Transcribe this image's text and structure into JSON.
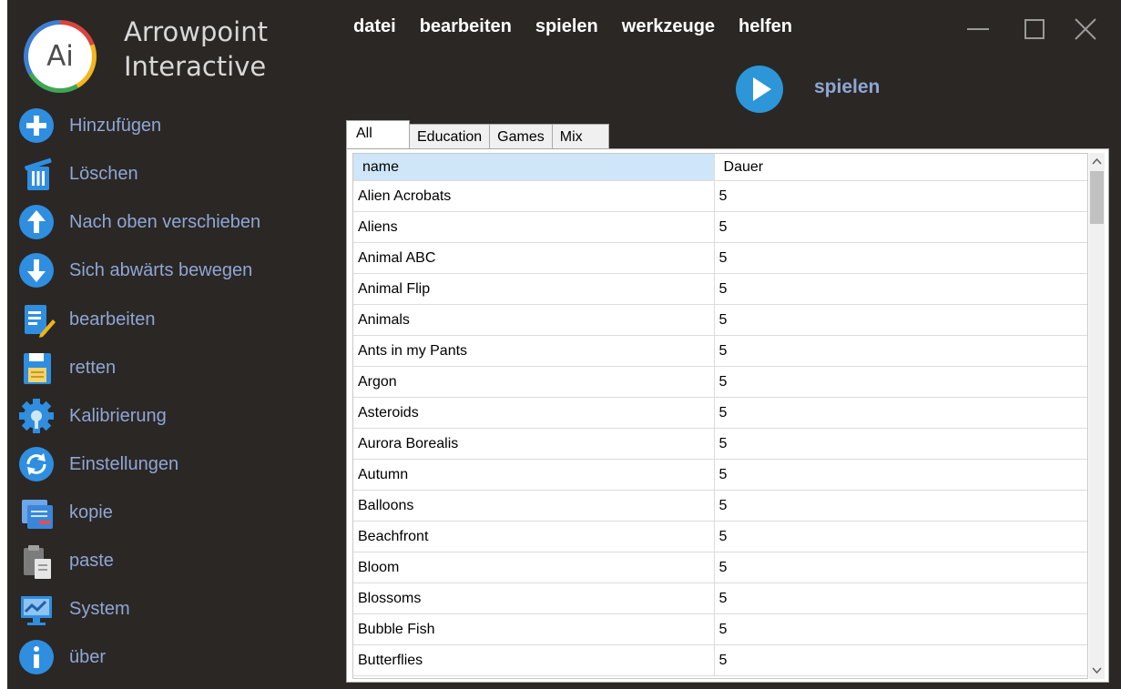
{
  "brand": {
    "logo_text": "Ai",
    "line1": "Arrowpoint",
    "line2": "Interactive"
  },
  "menu": [
    "datei",
    "bearbeiten",
    "spielen",
    "werkzeuge",
    "helfen"
  ],
  "play": {
    "label": "spielen"
  },
  "sidebar": [
    {
      "label": "Hinzufügen",
      "icon": "add-icon"
    },
    {
      "label": "Löschen",
      "icon": "trash-icon"
    },
    {
      "label": "Nach oben verschieben",
      "icon": "arrow-up-icon"
    },
    {
      "label": "Sich abwärts bewegen",
      "icon": "arrow-down-icon"
    },
    {
      "label": "bearbeiten",
      "icon": "edit-icon"
    },
    {
      "label": "retten",
      "icon": "save-icon"
    },
    {
      "label": "Kalibrierung",
      "icon": "calibration-gear-icon"
    },
    {
      "label": "Einstellungen",
      "icon": "refresh-settings-icon"
    },
    {
      "label": "kopie",
      "icon": "copy-icon"
    },
    {
      "label": "paste",
      "icon": "paste-icon"
    },
    {
      "label": "System",
      "icon": "system-monitor-icon"
    },
    {
      "label": "über",
      "icon": "info-icon"
    }
  ],
  "tabs": [
    "All",
    "Education",
    "Games",
    "Mix"
  ],
  "table": {
    "columns": [
      "name",
      "Dauer"
    ],
    "rows": [
      [
        "Alien Acrobats",
        "5"
      ],
      [
        "Aliens",
        "5"
      ],
      [
        "Animal ABC",
        "5"
      ],
      [
        "Animal Flip",
        "5"
      ],
      [
        "Animals",
        "5"
      ],
      [
        "Ants in my Pants",
        "5"
      ],
      [
        "Argon",
        "5"
      ],
      [
        "Asteroids",
        "5"
      ],
      [
        "Aurora Borealis",
        "5"
      ],
      [
        "Autumn",
        "5"
      ],
      [
        "Balloons",
        "5"
      ],
      [
        "Beachfront",
        "5"
      ],
      [
        "Bloom",
        "5"
      ],
      [
        "Blossoms",
        "5"
      ],
      [
        "Bubble Fish",
        "5"
      ],
      [
        "Butterflies",
        "5"
      ]
    ]
  },
  "colors": {
    "background": "#2b2724",
    "accent_blue": "#2c96d8",
    "sidebar_text": "#8ea7d6",
    "header_selected": "#cfe6f9"
  }
}
